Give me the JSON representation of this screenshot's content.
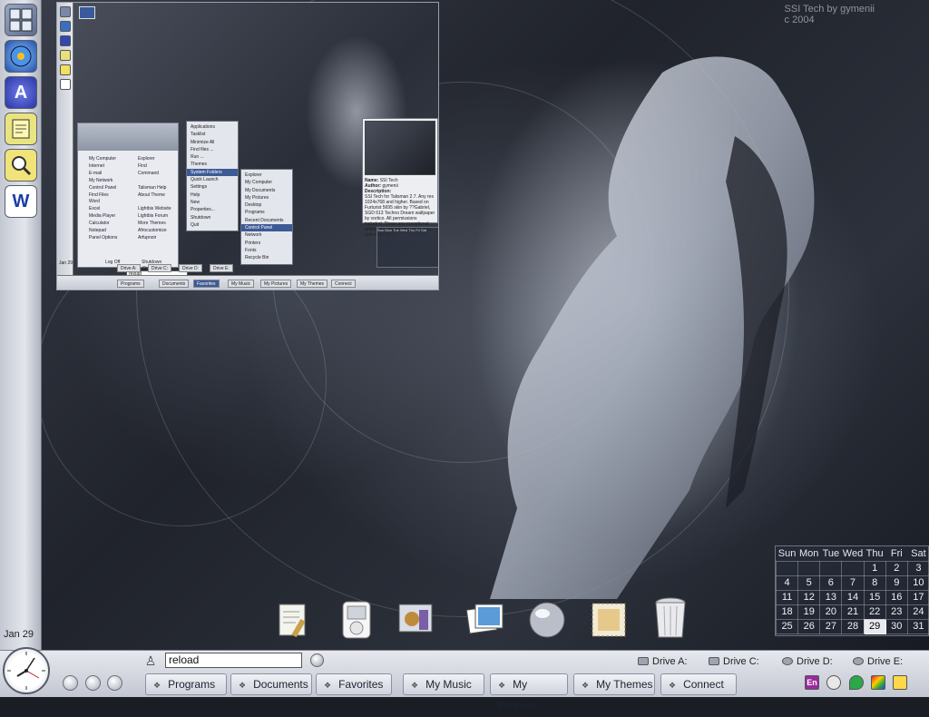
{
  "desktop": {
    "credit_line1": "SSI Tech by gymenii",
    "credit_line2": "c 2004"
  },
  "left_bar": {
    "icons": [
      {
        "name": "start-menu-icon"
      },
      {
        "name": "media-player-icon"
      },
      {
        "name": "aol-icon"
      },
      {
        "name": "notepad-icon"
      },
      {
        "name": "search-icon"
      },
      {
        "name": "word-icon"
      }
    ],
    "date": "Jan 29"
  },
  "quick_launch": {
    "command_value": "reload"
  },
  "drives": [
    "Drive A:",
    "Drive C:",
    "Drive D:",
    "Drive E:"
  ],
  "taskbar_tabs": [
    "Programs",
    "Documents",
    "Favorites",
    "My Music",
    "My Pictures",
    "My Themes",
    "Connect"
  ],
  "tray": {
    "language": "En"
  },
  "calendar": {
    "days": [
      "Sun",
      "Mon",
      "Tue",
      "Wed",
      "Thu",
      "Fri",
      "Sat"
    ],
    "weeks": [
      [
        "",
        "",
        "",
        "",
        "1",
        "2",
        "3"
      ],
      [
        "4",
        "5",
        "6",
        "7",
        "8",
        "9",
        "10"
      ],
      [
        "11",
        "12",
        "13",
        "14",
        "15",
        "16",
        "17"
      ],
      [
        "18",
        "19",
        "20",
        "21",
        "22",
        "23",
        "24"
      ],
      [
        "25",
        "26",
        "27",
        "28",
        "29",
        "30",
        "31"
      ]
    ],
    "today": "29"
  },
  "dock": [
    {
      "name": "documents-dock-icon"
    },
    {
      "name": "ipod-dock-icon"
    },
    {
      "name": "music-dock-icon"
    },
    {
      "name": "pictures-dock-icon"
    },
    {
      "name": "sphere-dock-icon"
    },
    {
      "name": "stamp-dock-icon"
    },
    {
      "name": "recycle-bin-dock-icon"
    }
  ],
  "preview": {
    "start_menu_left": [
      "My Computer",
      "Internet",
      "E-mail",
      "My Network",
      "Control Panel",
      "Find Files",
      "Word",
      "Excel",
      "Media Player",
      "Calculator",
      "Notepad"
    ],
    "start_menu_right": [
      "Explorer",
      "Find",
      "Command",
      "",
      "Talisman Help",
      "About Theme",
      "",
      "Lightbis Website",
      "Lightbis Forum",
      "More Themes",
      "Afrocustomize",
      "Arfupnoir"
    ],
    "panel_options": "Panel Options",
    "log_off": "Log Off",
    "shutdown": "Shutdown",
    "quicklaunch_label": "QuickLaunch",
    "command_value": "reload",
    "menu1": [
      "Applications",
      "Tasklist",
      "Minimize All",
      "Find files ...",
      "Run ...",
      "Themes",
      "System Folders",
      "Quick Launch",
      "Settings",
      "Help",
      "New",
      "Properties...",
      "Shutdown",
      "Quit"
    ],
    "menu2": [
      "Explorer",
      "My Computer",
      "My Documents",
      "My Pictures",
      "Desktop",
      "Programs",
      "Recent Documents",
      "Control Panel",
      "Network",
      "Printers",
      "Fonts",
      "Recycle Bin"
    ],
    "info_name_label": "Name:",
    "info_name": "SSI Tech",
    "info_author_label": "Author:",
    "info_author": "gymenii",
    "info_desc_label": "Description:",
    "info_desc": "SSI Tech for Talisman 2.7. Any res 1024x768 and higher. Based on Furturist 5695 skin by ??Gabriel, SGD 613 Techno Dream wallpaper by vortico. All permissions included. Those are exceptional artists, please visit their galleries, and mine too :)",
    "date": "Jan 29",
    "drives": [
      "Drive A:",
      "Drive C:",
      "Drive D:",
      "Drive E:"
    ],
    "tabs": [
      "Programs",
      "Documents",
      "Favorites",
      "My Music",
      "My Pictures",
      "My Themes",
      "Connect"
    ],
    "cal_days": [
      "Sun",
      "Mon",
      "Tue",
      "Wed",
      "Thu",
      "Fri",
      "Sat"
    ]
  }
}
